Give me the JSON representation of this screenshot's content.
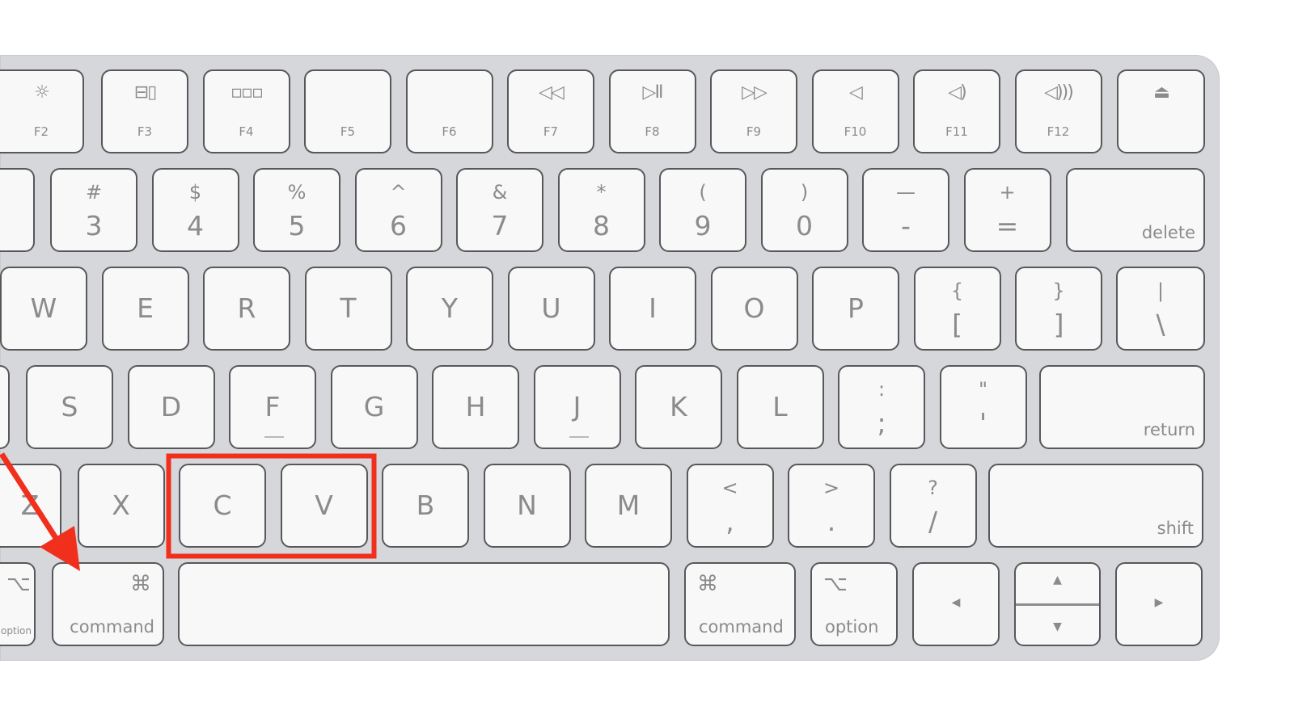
{
  "annotation": {
    "color": "#f0301c",
    "highlight": "highlight-box around C and V keys",
    "arrow": "arrow pointing to command key"
  },
  "colors": {
    "key": "#f8f8f8",
    "body": "#d6d7db",
    "legend": "#8b8b8d"
  },
  "rows": [
    {
      "keys": [
        {
          "type": "fn",
          "icon": "☼",
          "icon_name": "brightness-up-icon",
          "label": "F2"
        },
        {
          "type": "fn",
          "icon": "⊟▯",
          "icon_name": "mission-control-icon",
          "label": "F3"
        },
        {
          "type": "fn",
          "icon": "▫▫▫",
          "icon_name": "launchpad-icon",
          "label": "F4"
        },
        {
          "type": "fn",
          "icon": "",
          "label": "F5"
        },
        {
          "type": "fn",
          "icon": "",
          "label": "F6"
        },
        {
          "type": "fn",
          "icon": "◁◁",
          "icon_name": "rewind-icon",
          "label": "F7"
        },
        {
          "type": "fn",
          "icon": "▷II",
          "icon_name": "play-pause-icon",
          "label": "F8"
        },
        {
          "type": "fn",
          "icon": "▷▷",
          "icon_name": "fast-forward-icon",
          "label": "F9"
        },
        {
          "type": "fn",
          "icon": "◁",
          "icon_name": "mute-icon",
          "label": "F10"
        },
        {
          "type": "fn",
          "icon": "◁)",
          "icon_name": "volume-down-icon",
          "label": "F11"
        },
        {
          "type": "fn",
          "icon": "◁)))",
          "icon_name": "volume-up-icon",
          "label": "F12"
        },
        {
          "type": "fn",
          "icon": "⏏",
          "icon_name": "eject-icon",
          "label": ""
        }
      ]
    },
    {
      "keys": [
        {
          "type": "num",
          "top": "",
          "bottom": ""
        },
        {
          "type": "num",
          "top": "#",
          "bottom": "3"
        },
        {
          "type": "num",
          "top": "$",
          "bottom": "4"
        },
        {
          "type": "num",
          "top": "%",
          "bottom": "5"
        },
        {
          "type": "num",
          "top": "^",
          "bottom": "6"
        },
        {
          "type": "num",
          "top": "&",
          "bottom": "7"
        },
        {
          "type": "num",
          "top": "*",
          "bottom": "8"
        },
        {
          "type": "num",
          "top": "(",
          "bottom": "9"
        },
        {
          "type": "num",
          "top": ")",
          "bottom": "0"
        },
        {
          "type": "num",
          "top": "—",
          "bottom": "-"
        },
        {
          "type": "num",
          "top": "+",
          "bottom": "="
        },
        {
          "type": "mod",
          "label": "delete",
          "align": "br"
        }
      ]
    },
    {
      "keys": [
        {
          "type": "letter",
          "label": "W"
        },
        {
          "type": "letter",
          "label": "E"
        },
        {
          "type": "letter",
          "label": "R"
        },
        {
          "type": "letter",
          "label": "T"
        },
        {
          "type": "letter",
          "label": "Y"
        },
        {
          "type": "letter",
          "label": "U"
        },
        {
          "type": "letter",
          "label": "I"
        },
        {
          "type": "letter",
          "label": "O"
        },
        {
          "type": "letter",
          "label": "P"
        },
        {
          "type": "num",
          "top": "{",
          "bottom": "["
        },
        {
          "type": "num",
          "top": "}",
          "bottom": "]"
        },
        {
          "type": "num",
          "top": "|",
          "bottom": "\\"
        }
      ]
    },
    {
      "keys": [
        {
          "type": "letter",
          "label": ""
        },
        {
          "type": "letter",
          "label": "S"
        },
        {
          "type": "letter",
          "label": "D"
        },
        {
          "type": "letter",
          "label": "F",
          "bump": true
        },
        {
          "type": "letter",
          "label": "G"
        },
        {
          "type": "letter",
          "label": "H"
        },
        {
          "type": "letter",
          "label": "J",
          "bump": true
        },
        {
          "type": "letter",
          "label": "K"
        },
        {
          "type": "letter",
          "label": "L"
        },
        {
          "type": "num",
          "top": ":",
          "bottom": ";"
        },
        {
          "type": "num",
          "top": "\"",
          "bottom": "'"
        },
        {
          "type": "mod",
          "label": "return",
          "align": "br"
        }
      ]
    },
    {
      "keys": [
        {
          "type": "letter",
          "label": "Z"
        },
        {
          "type": "letter",
          "label": "X"
        },
        {
          "type": "letter",
          "label": "C"
        },
        {
          "type": "letter",
          "label": "V"
        },
        {
          "type": "letter",
          "label": "B"
        },
        {
          "type": "letter",
          "label": "N"
        },
        {
          "type": "letter",
          "label": "M"
        },
        {
          "type": "num",
          "top": "<",
          "bottom": ","
        },
        {
          "type": "num",
          "top": ">",
          "bottom": "."
        },
        {
          "type": "num",
          "top": "?",
          "bottom": "/"
        },
        {
          "type": "mod",
          "label": "shift",
          "align": "br"
        }
      ]
    },
    {
      "keys": [
        {
          "type": "mod",
          "label": "option",
          "align": "br",
          "glyph": "⌥",
          "glyph_align": "tr"
        },
        {
          "type": "mod",
          "label": "command",
          "align": "br",
          "glyph": "⌘",
          "glyph_align": "tr"
        },
        {
          "type": "mod",
          "label": "",
          "align": "br",
          "name": "space"
        },
        {
          "type": "mod",
          "label": "command",
          "align": "bl",
          "glyph": "⌘",
          "glyph_align": "tl"
        },
        {
          "type": "mod",
          "label": "option",
          "align": "bl",
          "glyph": "⌥",
          "glyph_align": "tl"
        },
        {
          "type": "arrow",
          "label": "◀",
          "name": "left-arrow"
        },
        {
          "type": "updown",
          "up": "▲",
          "down": "▼"
        },
        {
          "type": "arrow",
          "label": "▶",
          "name": "right-arrow"
        }
      ]
    }
  ]
}
